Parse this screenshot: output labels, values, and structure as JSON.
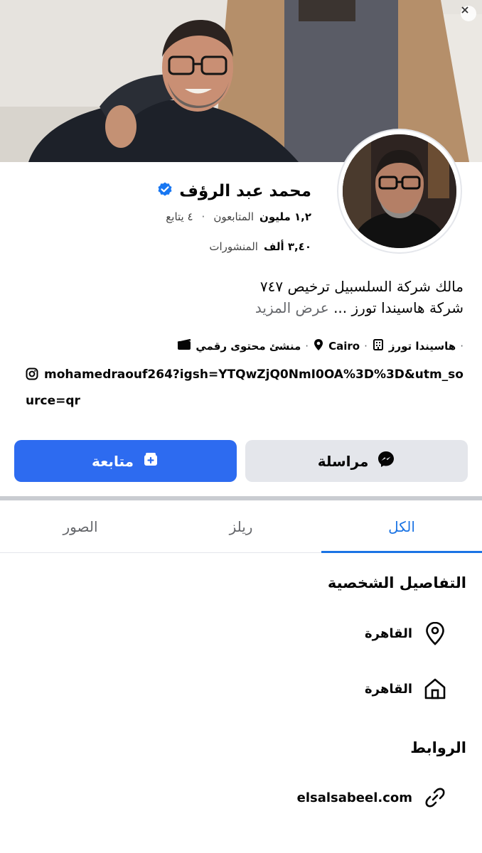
{
  "profile": {
    "name": "محمد عبد الرؤف",
    "followers_value": "١,٢ مليون",
    "followers_label": "المتابعون",
    "following": "٤ يتابع",
    "posts_value": "٣,٤٠ ألف",
    "posts_label": "المنشورات"
  },
  "bio": {
    "line1": "مالك شركة السلسبيل ترخيص ٧٤٧",
    "line2": "شركة هاسيندا تورز ...",
    "see_more": "عرض المزيد"
  },
  "meta": {
    "company": "هاسيندا تورز",
    "city": "Cairo",
    "category": "منشئ محتوى رقمي"
  },
  "instagram": {
    "handle": "mohamedraouf264?igsh=YTQwZjQ0NmI0OA%3D%3D&utm_source=qr"
  },
  "actions": {
    "message_label": "مراسلة",
    "follow_label": "متابعة"
  },
  "tabs": [
    {
      "label": "الكل",
      "active": true
    },
    {
      "label": "ريلز",
      "active": false
    },
    {
      "label": "الصور",
      "active": false
    }
  ],
  "details": {
    "title": "التفاصيل الشخصية",
    "location": "القاهرة",
    "home": "القاهرة"
  },
  "links": {
    "title": "الروابط",
    "website": "elsalsabeel.com"
  },
  "colors": {
    "primary": "#2d6bf0",
    "tab_active": "#1b74e4",
    "verified": "#1877f2"
  }
}
